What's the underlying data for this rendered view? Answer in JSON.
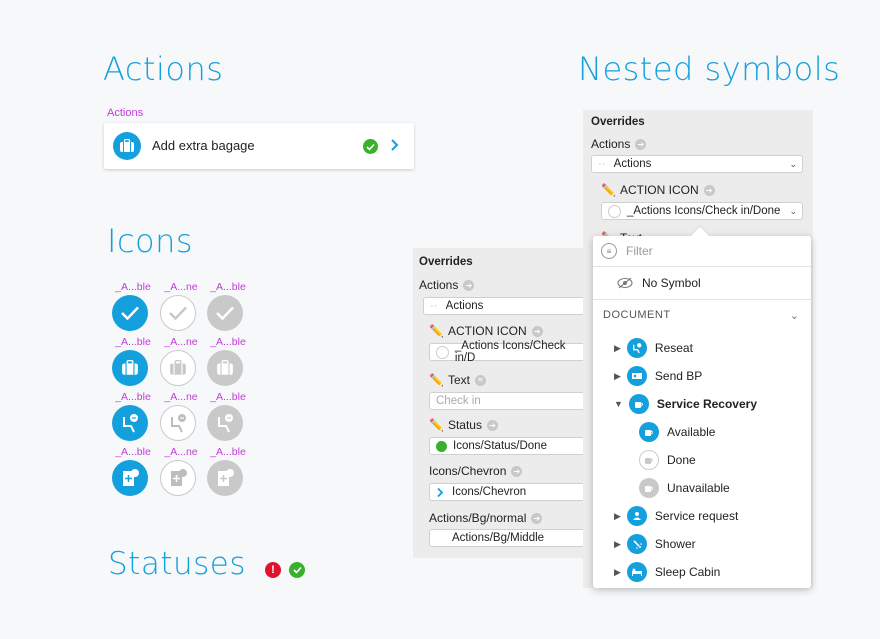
{
  "headings": {
    "actions": "Actions",
    "icons": "Icons",
    "statuses": "Statuses",
    "nested": "Nested symbols"
  },
  "actions_card": {
    "label": "Actions",
    "text": "Add extra bagage"
  },
  "icon_labels": [
    "_A...ble",
    "_A...ne",
    "_A...ble",
    "_A...ble",
    "_A...ne",
    "_A...ble",
    "_A...ble",
    "_A...ne",
    "_A...ble",
    "_A...ble",
    "_A...ne",
    "_A...ble"
  ],
  "left_panel": {
    "title": "Overrides",
    "actions_label": "Actions",
    "actions_value": "Actions",
    "action_icon_label": "ACTION ICON",
    "action_icon_value": "_Actions Icons/Check in/D",
    "text_label": "Text",
    "text_placeholder": "Check in",
    "status_label": "Status",
    "status_value": "Icons/Status/Done",
    "chevron_label": "Icons/Chevron",
    "chevron_value": "Icons/Chevron",
    "bg_label": "Actions/Bg/normal",
    "bg_value": "Actions/Bg/Middle"
  },
  "right_panel": {
    "title": "Overrides",
    "actions_label": "Actions",
    "actions_value": "Actions",
    "action_icon_label": "ACTION ICON",
    "action_icon_value": "_Actions Icons/Check in/Done",
    "text_label_partial": "Text"
  },
  "dropdown": {
    "filter_placeholder": "Filter",
    "no_symbol": "No Symbol",
    "section": "DOCUMENT",
    "items": [
      {
        "label": "Reseat",
        "expanded": false
      },
      {
        "label": "Send BP",
        "expanded": false
      },
      {
        "label": "Service Recovery",
        "expanded": true
      },
      {
        "label": "Available",
        "child": true,
        "state": "blue"
      },
      {
        "label": "Done",
        "child": true,
        "state": "outline"
      },
      {
        "label": "Unavailable",
        "child": true,
        "state": "grey"
      },
      {
        "label": "Service request",
        "expanded": false
      },
      {
        "label": "Shower",
        "expanded": false
      },
      {
        "label": "Sleep Cabin",
        "expanded": false
      }
    ]
  },
  "colors": {
    "accent": "#13a0dc",
    "success": "#3bb02e",
    "error": "#e0122e",
    "magenta": "#c33bd8"
  }
}
